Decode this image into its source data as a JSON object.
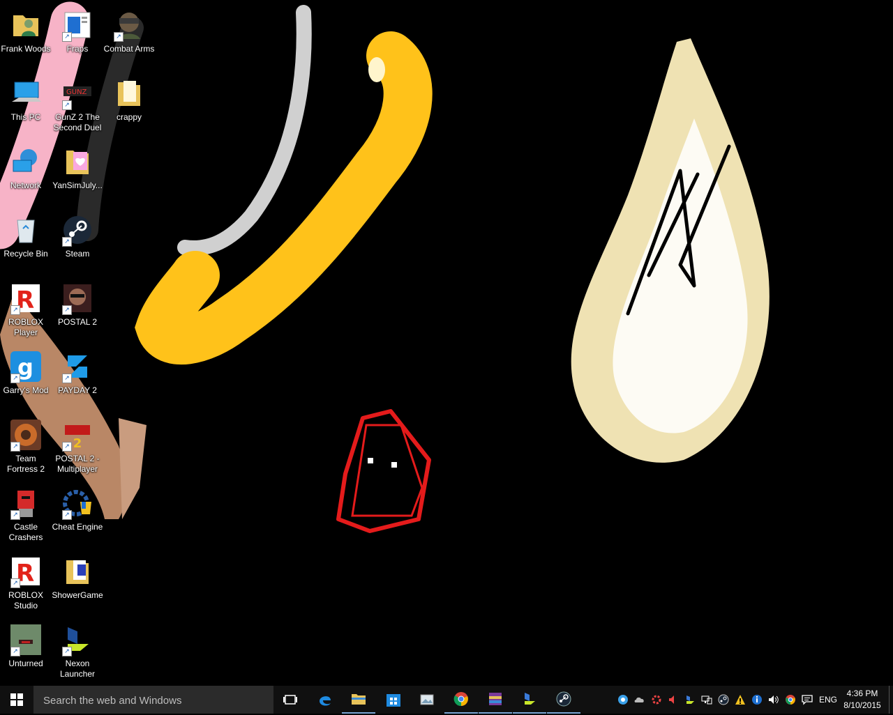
{
  "desktop": {
    "icons": [
      {
        "label": "Frank Woods",
        "icon": "user-folder-icon"
      },
      {
        "label": "Fraps",
        "icon": "fraps-icon"
      },
      {
        "label": "Combat Arms",
        "icon": "combat-arms-icon"
      },
      {
        "label": "This PC",
        "icon": "computer-icon"
      },
      {
        "label": "GunZ 2 The Second Duel",
        "icon": "gunz-icon"
      },
      {
        "label": "crappy",
        "icon": "folder-icon"
      },
      {
        "label": "Network",
        "icon": "network-icon"
      },
      {
        "label": "YanSimJuly...",
        "icon": "heart-folder-icon"
      },
      {
        "label": "Recycle Bin",
        "icon": "recycle-bin-icon"
      },
      {
        "label": "Steam",
        "icon": "steam-icon"
      },
      {
        "label": "ROBLOX Player",
        "icon": "roblox-icon"
      },
      {
        "label": "POSTAL 2",
        "icon": "postal-icon"
      },
      {
        "label": "Garry's Mod",
        "icon": "garrys-mod-icon"
      },
      {
        "label": "PAYDAY 2",
        "icon": "payday-icon"
      },
      {
        "label": "Team Fortress 2",
        "icon": "tf2-icon"
      },
      {
        "label": "POSTAL 2 - Multiplayer",
        "icon": "postal-mp-icon"
      },
      {
        "label": "Castle Crashers",
        "icon": "castle-crashers-icon"
      },
      {
        "label": "Cheat Engine",
        "icon": "cheat-engine-icon"
      },
      {
        "label": "ROBLOX Studio",
        "icon": "roblox-studio-icon"
      },
      {
        "label": "ShowerGame",
        "icon": "document-folder-icon"
      },
      {
        "label": "Unturned",
        "icon": "unturned-icon"
      },
      {
        "label": "Nexon Launcher",
        "icon": "nexon-icon"
      }
    ]
  },
  "taskbar": {
    "search_placeholder": "Search the web and Windows",
    "language": "ENG",
    "time": "4:36 PM",
    "date": "8/10/2015"
  },
  "colors": {
    "taskbar": "#101010",
    "search_box": "#2b2b2b",
    "accent": "#7aa7d6"
  }
}
